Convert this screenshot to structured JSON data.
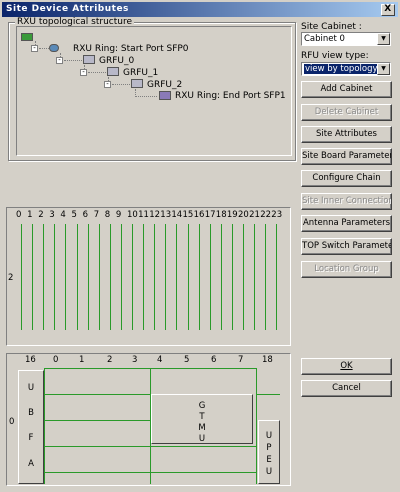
{
  "window": {
    "title": "Site Device Attributes",
    "close": "X"
  },
  "tree": {
    "group_label": "RXU topological structure",
    "expander": "-",
    "nodes": [
      {
        "label": "RXU Ring:  Start Port SFP0"
      },
      {
        "label": "GRFU_0"
      },
      {
        "label": "GRFU_1"
      },
      {
        "label": "GRFU_2"
      },
      {
        "label": "RXU Ring:  End Port SFP1"
      }
    ]
  },
  "right": {
    "cabinet_label": "Site Cabinet :",
    "cabinet_value": "Cabinet 0",
    "view_type_label": "RFU view type:",
    "view_type_value": "view by topology",
    "buttons": [
      {
        "label": "Add Cabinet",
        "enabled": true
      },
      {
        "label": "Delete Cabinet",
        "enabled": false
      },
      {
        "label": "Site Attributes",
        "enabled": true
      },
      {
        "label": "Site Board Parameters",
        "enabled": true
      },
      {
        "label": "Configure Chain",
        "enabled": true
      },
      {
        "label": "Site Inner Connection",
        "enabled": false
      },
      {
        "label": "Antenna Parameters",
        "enabled": true
      },
      {
        "label": "TOP Switch Parameters",
        "enabled": true
      },
      {
        "label": "Location Group",
        "enabled": false
      }
    ],
    "ok": "OK",
    "cancel": "Cancel"
  },
  "rfu_panel": {
    "row_label": "2",
    "slots": [
      "0",
      "1",
      "2",
      "3",
      "4",
      "5",
      "6",
      "7",
      "8",
      "9",
      "10",
      "11",
      "12",
      "13",
      "14",
      "15",
      "16",
      "17",
      "18",
      "19",
      "20",
      "21",
      "22",
      "23"
    ]
  },
  "bbu_panel": {
    "row_label": "0",
    "slots": [
      "16",
      "0",
      "1",
      "2",
      "3",
      "4",
      "5",
      "6",
      "7",
      "18"
    ],
    "boards": {
      "ubfa": [
        "U",
        "B",
        "F",
        "A"
      ],
      "gtmu": [
        "G",
        "T",
        "M",
        "U"
      ],
      "upeu": [
        "U",
        "P",
        "E",
        "U"
      ]
    }
  },
  "colors": {
    "slot_line": "#2a9a2a",
    "title_start": "#0a246a",
    "title_end": "#a6caf0"
  }
}
